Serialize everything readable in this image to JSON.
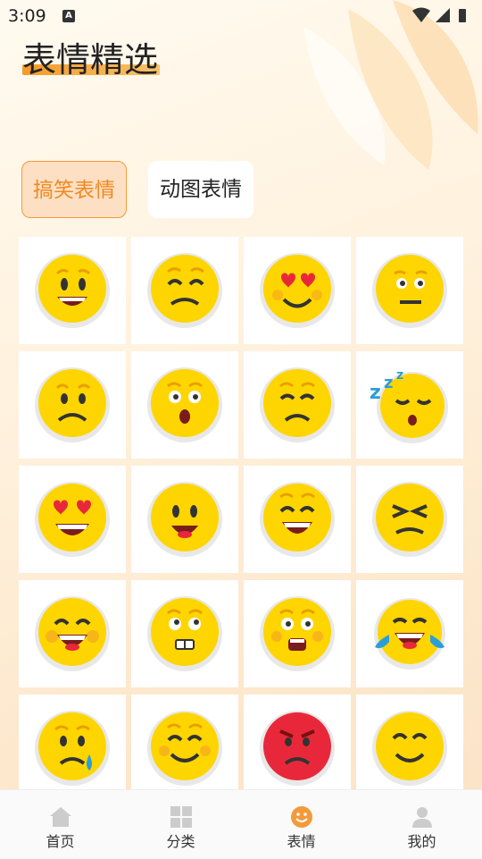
{
  "status": {
    "time": "3:09",
    "notification_icon": "A"
  },
  "header": {
    "title": "表情精选"
  },
  "tabs": [
    {
      "label": "搞笑表情",
      "active": true
    },
    {
      "label": "动图表情",
      "active": false
    }
  ],
  "emojis": [
    "smile-grin",
    "squint-frown",
    "heart-eyes",
    "neutral-flat",
    "worried",
    "surprised",
    "sad-squint",
    "sleeping-zzz",
    "heart-eyes-laugh",
    "simple-smile",
    "happy-squint",
    "persevering",
    "wink-laugh",
    "rolling-eyes-teeth",
    "shocked-blush",
    "tears-of-joy",
    "crying-tear",
    "content-smile",
    "angry-red",
    "smile-squint"
  ],
  "bottom_nav": [
    {
      "label": "首页",
      "icon": "home-icon"
    },
    {
      "label": "分类",
      "icon": "grid-icon"
    },
    {
      "label": "表情",
      "icon": "emoji-icon",
      "active": true
    },
    {
      "label": "我的",
      "icon": "user-icon"
    }
  ],
  "colors": {
    "accent": "#f39a3a",
    "emoji_yellow": "#ffd500",
    "angry_red": "#e8283a"
  }
}
